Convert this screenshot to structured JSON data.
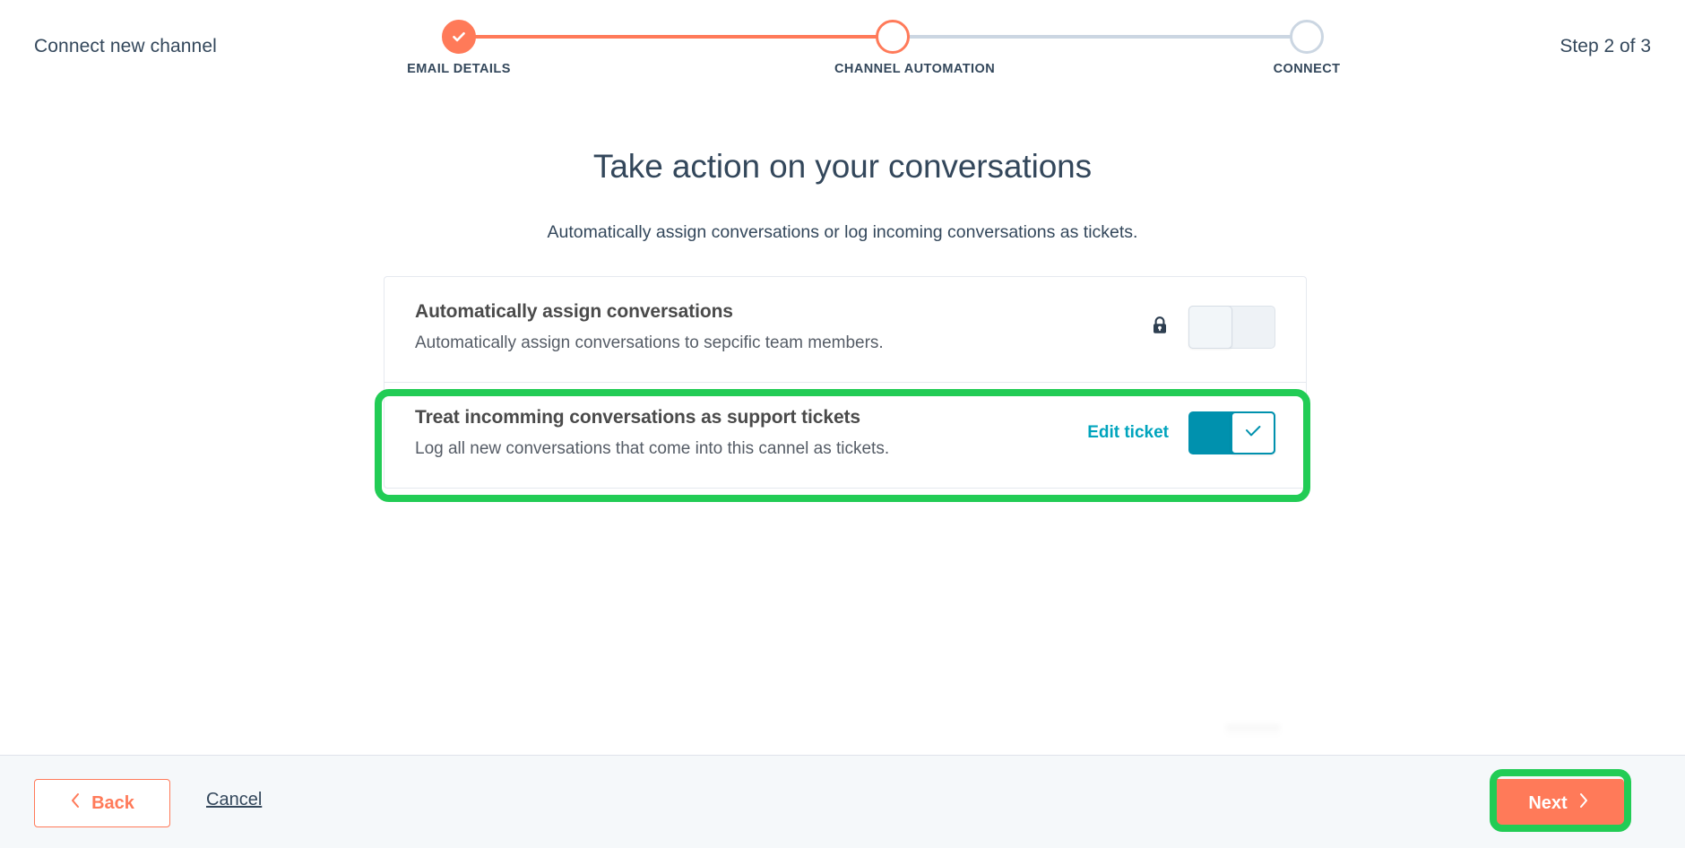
{
  "header": {
    "title": "Connect new channel",
    "step_counter": "Step 2 of 3"
  },
  "stepper": {
    "steps": [
      {
        "label": "EMAIL DETAILS",
        "state": "done",
        "icon": "check-icon"
      },
      {
        "label": "CHANNEL AUTOMATION",
        "state": "active",
        "icon": "circle-icon"
      },
      {
        "label": "CONNECT",
        "state": "inactive",
        "icon": "circle-icon"
      }
    ],
    "colors": {
      "active": "#ff7a59",
      "inactive": "#cbd6e2"
    }
  },
  "main": {
    "title": "Take action on your conversations",
    "subtitle": "Automatically assign conversations or log incoming conversations as tickets.",
    "rows": [
      {
        "title": "Automatically assign conversations",
        "description": "Automatically assign conversations to sepcific team members.",
        "lock_icon": "lock-icon",
        "toggle_state": "off",
        "edit_link": null
      },
      {
        "title": "Treat incomming conversations as support tickets",
        "description": "Log all new conversations that come into this cannel as tickets.",
        "lock_icon": null,
        "toggle_state": "on",
        "edit_link": "Edit ticket"
      }
    ]
  },
  "footer": {
    "back_label": "Back",
    "cancel_label": "Cancel",
    "next_label": "Next"
  },
  "annotations": {
    "color": "#22cc55",
    "targets": [
      "support-ticket-row",
      "next-button"
    ]
  },
  "colors": {
    "brand_orange": "#ff7a59",
    "teal": "#0091ae",
    "link_teal": "#00a4bd",
    "navy": "#33475b",
    "footer_bg": "#f5f8fa",
    "border": "#e5e9ef"
  }
}
